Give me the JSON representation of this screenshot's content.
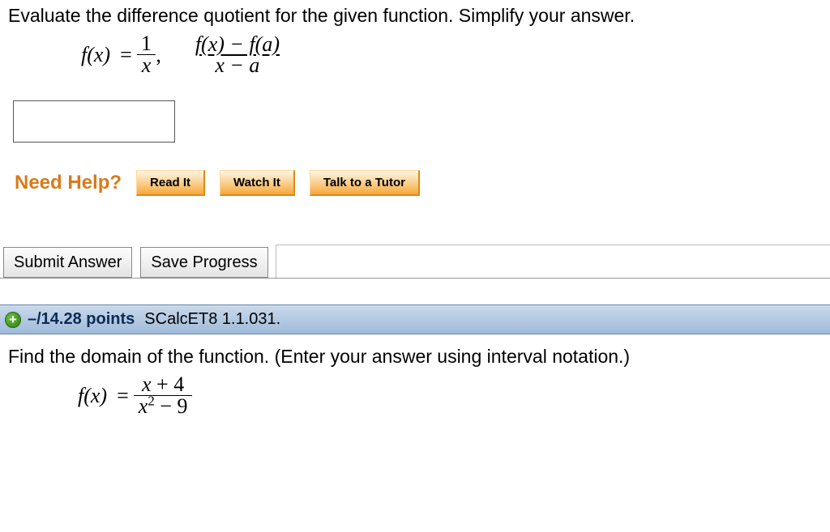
{
  "q1": {
    "prompt": "Evaluate the difference quotient for the given function. Simplify your answer.",
    "func_lhs": "f(x)",
    "eq": "=",
    "frac1_num": "1",
    "frac1_den": "x",
    "comma": ",",
    "dq_num": "f(x) − f(a)",
    "dq_den": "x − a",
    "help_label": "Need Help?",
    "btn_read": "Read It",
    "btn_watch": "Watch It",
    "btn_tutor": "Talk to a Tutor",
    "btn_submit": "Submit Answer",
    "btn_save": "Save Progress"
  },
  "q2": {
    "score": "–/14.28",
    "points_word": "points",
    "id": "SCalcET8 1.1.031.",
    "prompt": "Find the domain of the function. (Enter your answer using interval notation.)",
    "func_lhs": "f(x)",
    "eq": "=",
    "num_a": "x",
    "num_plus": " + ",
    "num_b": "4",
    "den_a": "x",
    "den_exp": "2",
    "den_minus": " − ",
    "den_b": "9"
  }
}
